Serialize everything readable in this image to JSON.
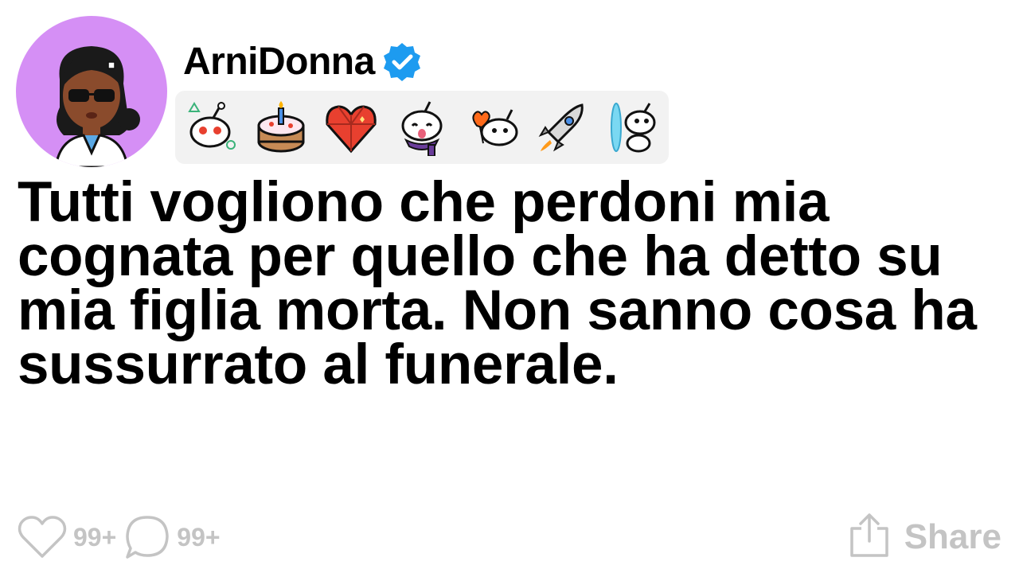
{
  "post": {
    "username": "ArniDonna",
    "verified": true,
    "title": "Tutti vogliono che perdoni mia cognata per quello che ha detto su mia figlia morta. Non sanno cosa ha sussurrato al funerale.",
    "awards": [
      "snoo-thinking-icon",
      "birthday-cake-icon",
      "gem-heart-icon",
      "snoo-tongue-scarf-icon",
      "snoo-heart-balloons-icon",
      "rocket-icon",
      "snoo-portal-icon"
    ]
  },
  "footer": {
    "likes": "99+",
    "comments": "99+",
    "share_label": "Share"
  },
  "colors": {
    "avatar_bg": "#d58ff5",
    "verified_blue": "#1d9bf0",
    "muted": "#c4c4c4",
    "award_strip_bg": "#f2f2f2"
  }
}
